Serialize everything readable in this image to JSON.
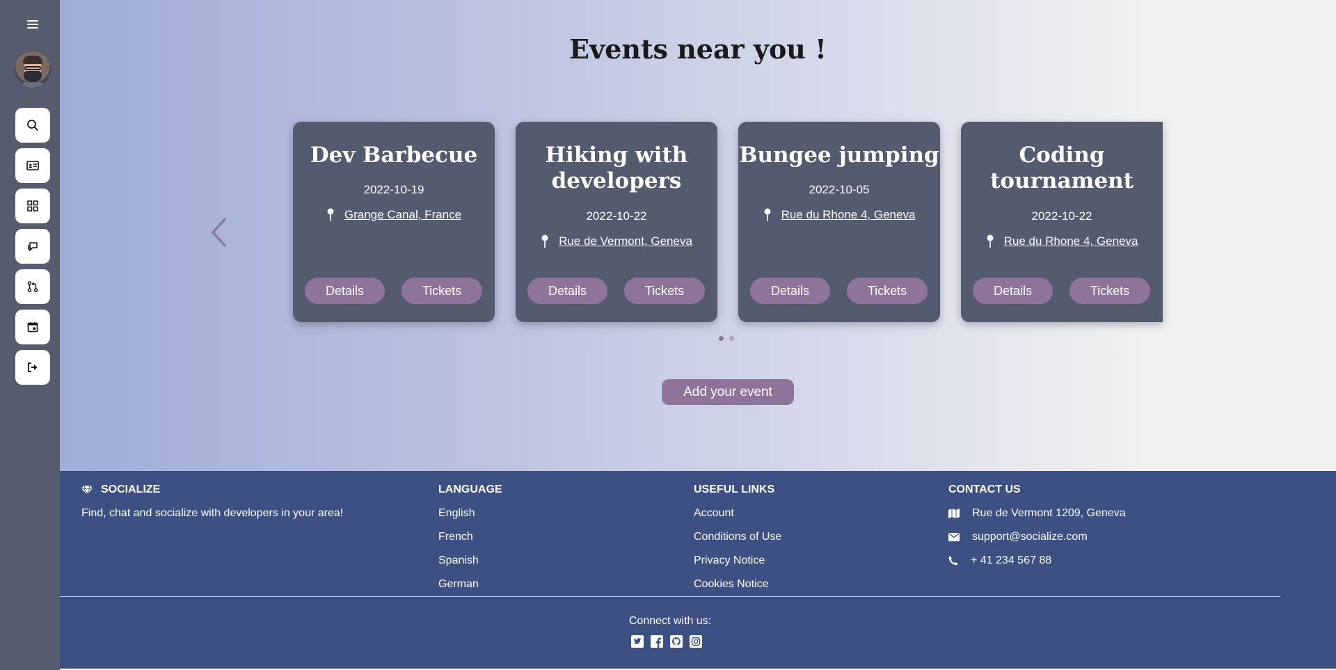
{
  "page": {
    "title": "Events near you !",
    "add_event_label": "Add your event"
  },
  "sidebar": {
    "menu_icon": "hamburger-icon",
    "items": [
      {
        "name": "search",
        "icon": "search-icon"
      },
      {
        "name": "profile-card",
        "icon": "id-card-icon"
      },
      {
        "name": "dashboard",
        "icon": "grid-icon"
      },
      {
        "name": "chat",
        "icon": "chat-icon"
      },
      {
        "name": "git",
        "icon": "git-pull-request-icon"
      },
      {
        "name": "calendar",
        "icon": "calendar-icon"
      },
      {
        "name": "logout",
        "icon": "logout-icon"
      }
    ]
  },
  "events": [
    {
      "title": "Dev Barbecue",
      "date": "2022-10-19",
      "location": "Grange Canal, France",
      "details_label": "Details",
      "tickets_label": "Tickets"
    },
    {
      "title": "Hiking with developers",
      "date": "2022-10-22",
      "location": "Rue de Vermont, Geneva",
      "details_label": "Details",
      "tickets_label": "Tickets"
    },
    {
      "title": "Bungee jumping",
      "date": "2022-10-05",
      "location": "Rue du Rhone 4, Geneva",
      "details_label": "Details",
      "tickets_label": "Tickets"
    },
    {
      "title": "Coding tournament",
      "date": "2022-10-22",
      "location": "Rue du Rhone 4, Geneva",
      "details_label": "Details",
      "tickets_label": "Tickets"
    }
  ],
  "carousel": {
    "page_count": 2,
    "active_page": 1
  },
  "footer": {
    "brand": {
      "name": "SOCIALIZE",
      "tagline": "Find, chat and socialize with developers in your area!",
      "icon": "gem-icon"
    },
    "language": {
      "heading": "LANGUAGE",
      "items": [
        "English",
        "French",
        "Spanish",
        "German"
      ]
    },
    "useful_links": {
      "heading": "USEFUL LINKS",
      "items": [
        "Account",
        "Conditions of Use",
        "Privacy Notice",
        "Cookies Notice"
      ]
    },
    "contact": {
      "heading": "CONTACT US",
      "address": "Rue de Vermont 1209, Geneva",
      "email": "support@socialize.com",
      "phone": "+ 41 234 567 88"
    },
    "connect_label": "Connect with us:",
    "socials": [
      "twitter-icon",
      "facebook-icon",
      "github-icon",
      "instagram-icon"
    ]
  },
  "colors": {
    "sidebar": "#565b6e",
    "card": "#555b6f",
    "accent": "#8e749a",
    "footer": "#3d5084"
  }
}
